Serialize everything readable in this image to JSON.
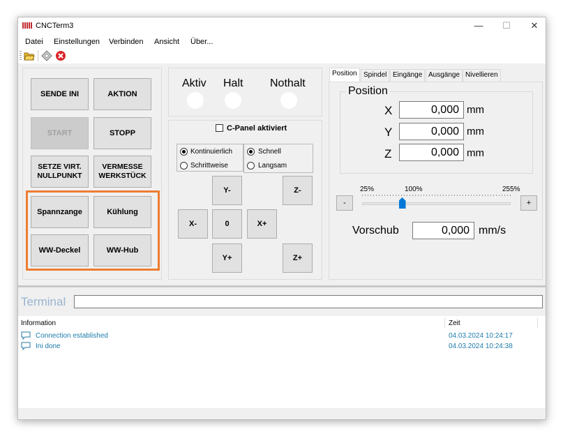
{
  "window": {
    "title": "CNCTerm3",
    "controls": {
      "minimize": "—",
      "maximize": "☐",
      "close": "✕"
    }
  },
  "menu": [
    "Datei",
    "Einstellungen",
    "Verbinden",
    "Ansicht",
    "Über..."
  ],
  "buttons": {
    "sende_ini": "SENDE INI",
    "aktion": "AKTION",
    "start": "START",
    "stopp": "STOPP",
    "setze": "SETZE VIRT. NULLPUNKT",
    "vermesse": "VERMESSE WERKSTÜCK",
    "spannzange": "Spannzange",
    "kuehlung": "Kühlung",
    "ww_deckel": "WW-Deckel",
    "ww_hub": "WW-Hub"
  },
  "status": {
    "aktiv": "Aktiv",
    "halt": "Halt",
    "nothalt": "Nothalt"
  },
  "cpanel": "C-Panel aktiviert",
  "mode": {
    "kont": "Kontinuierlich",
    "schritt": "Schrittweise",
    "schnell": "Schnell",
    "langsam": "Langsam"
  },
  "jog": {
    "y_minus": "Y-",
    "z_minus": "Z-",
    "x_minus": "X-",
    "zero": "0",
    "x_plus": "X+",
    "y_plus": "Y+",
    "z_plus": "Z+"
  },
  "tabs": [
    "Position",
    "Spindel",
    "Eingänge",
    "Ausgänge",
    "Nivellieren"
  ],
  "position": {
    "title": "Position",
    "x_label": "X",
    "y_label": "Y",
    "z_label": "Z",
    "x": "0,000",
    "y": "0,000",
    "z": "0,000",
    "unit": "mm"
  },
  "override": {
    "min": "25%",
    "mid": "100%",
    "max": "255%",
    "minus": "-",
    "plus": "+",
    "value": 0.27
  },
  "feed": {
    "label": "Vorschub",
    "value": "0,000",
    "unit": "mm/s"
  },
  "terminal": {
    "label": "Terminal",
    "input": ""
  },
  "log": {
    "col_info": "Information",
    "col_time": "Zeit",
    "rows": [
      {
        "msg": "Connection established",
        "time": "04.03.2024 10:24:17"
      },
      {
        "msg": "Ini done",
        "time": "04.03.2024 10:24:38"
      }
    ]
  }
}
